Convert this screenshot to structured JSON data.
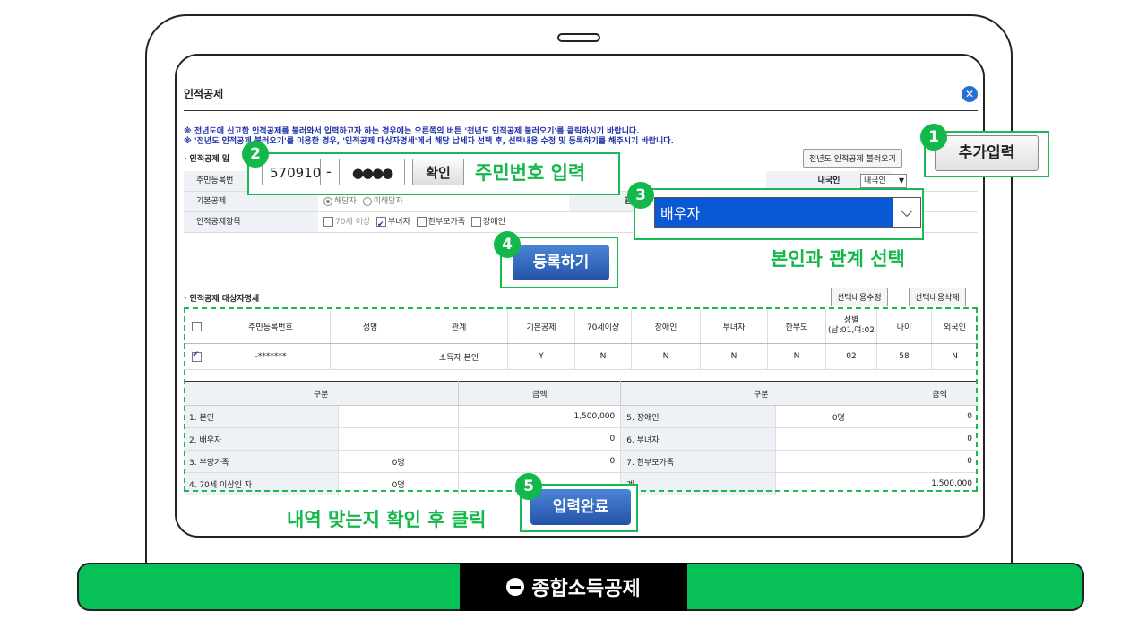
{
  "dialog": {
    "title": "인적공제",
    "close_glyph": "✕",
    "notice1": "※ 전년도에 신고한 인적공제를 불러와서 입력하고자 하는 경우에는 오른쪽의 버튼 '전년도 인적공제 불러오기'를 클릭하시기 바랍니다.",
    "notice2": "※ '전년도 인적공제 불러오기'를 이용한 경우, '인적공제 대상자명세'에서 해당 납세자 선택 후, 선택내용 수정 및 등록하기를 해주시기 바랍니다.",
    "section_input": "· 인적공제 입",
    "load_prev_button": "전년도 인적공제 불러오기",
    "rows": {
      "rrn_label": "주민등록번",
      "basic_label": "기본공제",
      "basic_opt1": "해당자",
      "basic_opt2": "미해당자",
      "items_label": "인적공제항목",
      "item1": "70세 이상",
      "item2": "부녀자",
      "item3": "한부모가족",
      "item4": "장애인",
      "relation_label": "관계",
      "nationality_label": "내국인",
      "nationality_value": "내국인"
    },
    "section_list": "· 인적공제 대상자명세",
    "edit_button": "선택내용수정",
    "delete_button": "선택내용삭제",
    "list_headers": [
      "주민등록번호",
      "성명",
      "관계",
      "기본공제",
      "70세이상",
      "장애인",
      "부녀자",
      "한부모",
      "성별\n(남:01,여:02",
      "나이",
      "외국인"
    ],
    "list_rows": [
      {
        "rrn": "-*******",
        "name": "",
        "relation": "소득자 본인",
        "basic": "Y",
        "over70": "N",
        "disabled": "N",
        "woman": "N",
        "single": "N",
        "gender": "02",
        "age": "58",
        "foreign": "N"
      }
    ],
    "summary_headers": [
      "구분",
      "금액",
      "구분",
      "금액"
    ],
    "summary": [
      {
        "l_label": "1. 본인",
        "l_count": "",
        "l_amount": "1,500,000",
        "r_label": "5. 장애인",
        "r_count": "0명",
        "r_amount": "0"
      },
      {
        "l_label": "2. 배우자",
        "l_count": "",
        "l_amount": "0",
        "r_label": "6. 부녀자",
        "r_count": "",
        "r_amount": "0"
      },
      {
        "l_label": "3. 부양가족",
        "l_count": "0명",
        "l_amount": "0",
        "r_label": "7. 한부모가족",
        "r_count": "",
        "r_amount": "0"
      },
      {
        "l_label": "4. 70세 이상인 자",
        "l_count": "0명",
        "l_amount": "",
        "r_label": "계",
        "r_count": "",
        "r_amount": "1,500,000"
      }
    ]
  },
  "callouts": {
    "b1": "1",
    "add_input": "추가입력",
    "b2": "2",
    "rrn_front": "570910",
    "rrn_dash": "-",
    "rrn_back": "●●●●",
    "confirm": "확인",
    "rrn_caption": "주민번호 입력",
    "b3": "3",
    "relation_value": "배우자",
    "relation_caption": "본인과 관계 선택",
    "b4": "4",
    "register": "등록하기",
    "b5": "5",
    "complete": "입력완료",
    "complete_caption": "내역 맞는지 확인 후 클릭"
  },
  "footer": {
    "label": "종합소득공제"
  },
  "colors": {
    "accent_green": "#13b84a",
    "footer_green": "#07c158",
    "button_blue": "#2453a8"
  }
}
